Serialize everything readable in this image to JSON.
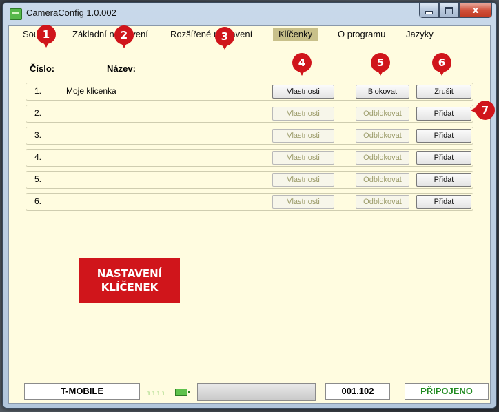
{
  "window": {
    "title": "CameraConfig 1.0.002",
    "close_glyph": "x"
  },
  "menu": [
    {
      "label": "Soubor"
    },
    {
      "label": "Základní nastavení"
    },
    {
      "label": "Rozšířené nastavení"
    },
    {
      "label": "Klíčenky"
    },
    {
      "label": "O programu"
    },
    {
      "label": "Jazyky"
    }
  ],
  "headers": {
    "number": "Číslo:",
    "name": "Název:"
  },
  "rows": [
    {
      "num": "1.",
      "name": "Moje klicenka",
      "props": "Vlastnosti",
      "block": "Blokovat",
      "action": "Zrušit",
      "enabled": true
    },
    {
      "num": "2.",
      "name": "",
      "props": "Vlastnosti",
      "block": "Odblokovat",
      "action": "Přidat",
      "enabled": false
    },
    {
      "num": "3.",
      "name": "",
      "props": "Vlastnosti",
      "block": "Odblokovat",
      "action": "Přidat",
      "enabled": false
    },
    {
      "num": "4.",
      "name": "",
      "props": "Vlastnosti",
      "block": "Odblokovat",
      "action": "Přidat",
      "enabled": false
    },
    {
      "num": "5.",
      "name": "",
      "props": "Vlastnosti",
      "block": "Odblokovat",
      "action": "Přidat",
      "enabled": false
    },
    {
      "num": "6.",
      "name": "",
      "props": "Vlastnosti",
      "block": "Odblokovat",
      "action": "Přidat",
      "enabled": false
    }
  ],
  "status": {
    "operator": "T-MOBILE",
    "signal": "ıııı",
    "version": "001.102",
    "connection": "PŘIPOJENO",
    "connection_color": "#1e8a1e"
  },
  "markers": [
    "1",
    "2",
    "3",
    "4",
    "5",
    "6",
    "7"
  ],
  "callout": {
    "line1": "NASTAVENÍ",
    "line2": "KLÍČENEK"
  },
  "colors": {
    "accent": "#d0151b",
    "panel": "#fffce0",
    "active_menu": "#c8c08a"
  }
}
